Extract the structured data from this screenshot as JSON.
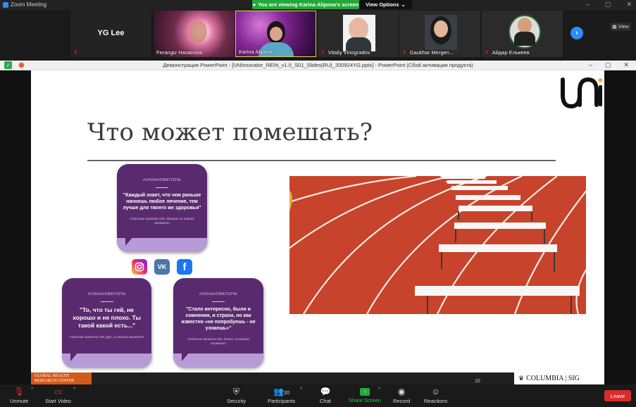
{
  "zoom": {
    "window_title": "Zoom Meeting",
    "banner": "You are viewing Karina Alipova's screen",
    "view_options": "View Options",
    "view": "View"
  },
  "participants": [
    {
      "name": "YG Lee",
      "big_name": "YG Lee",
      "muted": true
    },
    {
      "name": "Ferangiz Hasanova",
      "muted": false
    },
    {
      "name": "Karina Alipova",
      "muted": false,
      "active_speaker": true
    },
    {
      "name": "Vitaliy Vinogradov",
      "muted": true
    },
    {
      "name": "Gaukhar Mergen...",
      "muted": true
    },
    {
      "name": "Айдар Елькеев",
      "muted": true
    }
  ],
  "ppt": {
    "window_title": "Демонстрация PowerPoint - [UNInnovator_REIN_v1.0_S01_Slides(RU)_200924YG.pptx] - PowerPoint (Сбой активации продукта)"
  },
  "slide": {
    "title": "Что может помешать?",
    "slide_number": "10",
    "footer_left": "GLOBAL HEALTH RESEARCH CENTER",
    "footer_right": "COLUMBIA | SIG",
    "cards": [
      {
        "tag": "#UNIННОВАТОРЫ",
        "quote": "\"Каждый знает, что чем раньше начнешь любое лечение, тем лучше для твоего же здоровья\"",
        "source": "Участник проекта UNI, Максим, из города Шымкент"
      },
      {
        "tag": "#UNIННОВАТОРЫ",
        "quote": "\"То, что ты гей, не хорошо и не плохо. Ты такой какой есть...\"",
        "source": "Участник проекта UNI, Дос, из города Шымкент"
      },
      {
        "tag": "#UNIННОВАТОРЫ",
        "quote": "\"Стало интересно, были и сомнения, и страхи, но как известно «не попробуешь - не узнаешь»\"",
        "source": "Участник проекта UNI, Ильях, из города Шымкент"
      }
    ],
    "social_icons": [
      "instagram-icon",
      "vk-icon",
      "facebook-icon"
    ]
  },
  "toolbar": {
    "unmute": "Unmute",
    "start_video": "Start Video",
    "security": "Security",
    "participants": "Participants",
    "participants_count": "20",
    "chat": "Chat",
    "share_screen": "Share Screen",
    "record": "Record",
    "reactions": "Reactions",
    "leave": "Leave"
  },
  "colors": {
    "zoom_green": "#23a83b",
    "zoom_blue": "#2d8cff",
    "leave_red": "#d92d2d",
    "card_purple": "#5a2a6e",
    "card_lavender": "#b79bd6",
    "track_red": "#c8432b"
  }
}
